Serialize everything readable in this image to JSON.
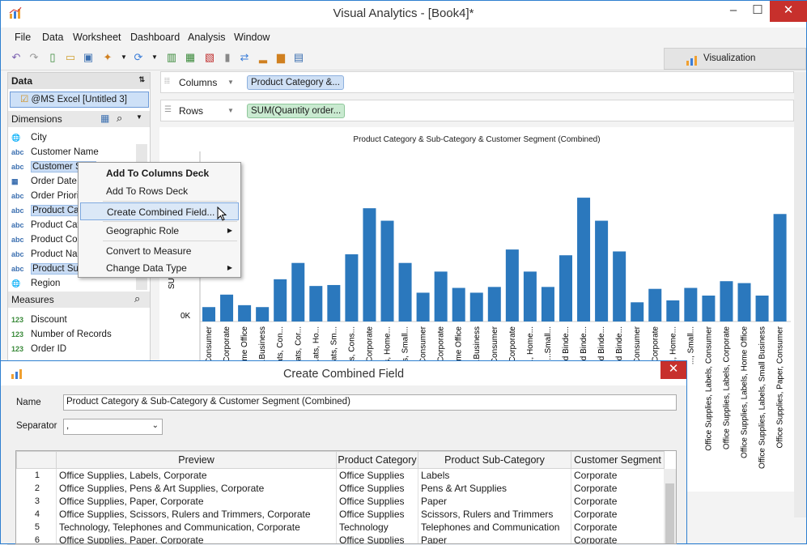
{
  "window": {
    "title": "Visual Analytics - [Book4]*",
    "min": "–",
    "max": "☐",
    "close": "✕"
  },
  "menu": [
    "File",
    "Data",
    "Worksheet",
    "Dashboard",
    "Analysis",
    "Window"
  ],
  "toolbar": {
    "viz_tab": "Visualization"
  },
  "data_panel": {
    "header": "Data",
    "source": "@MS Excel [Untitled 3]",
    "dimensions_header": "Dimensions",
    "dimensions": [
      {
        "type": "globe",
        "label": "City"
      },
      {
        "type": "abc",
        "label": "Customer Name"
      },
      {
        "type": "abc",
        "label": "Customer Se..."
      },
      {
        "type": "date",
        "label": "Order Date"
      },
      {
        "type": "abc",
        "label": "Order Priorit..."
      },
      {
        "type": "abc",
        "label": "Product Cat..."
      },
      {
        "type": "abc",
        "label": "Product Cat..."
      },
      {
        "type": "abc",
        "label": "Product Con..."
      },
      {
        "type": "abc",
        "label": "Product Nam..."
      },
      {
        "type": "abc",
        "label": "Product Sub..."
      },
      {
        "type": "globe",
        "label": "Region"
      }
    ],
    "measures_header": "Measures",
    "measures": [
      {
        "type": "123",
        "label": "Discount"
      },
      {
        "type": "123",
        "label": "Number of Records"
      },
      {
        "type": "123",
        "label": "Order ID"
      }
    ]
  },
  "shelves": {
    "columns_label": "Columns",
    "columns_pill": "Product Category &...",
    "rows_label": "Rows",
    "rows_pill": "SUM(Quantity order..."
  },
  "chart_data": {
    "type": "bar",
    "title": "Product Category & Sub-Category & Customer Segment (Combined)",
    "ylabel": "SU...",
    "ytick": "0K",
    "categories": [
      "...Consumer",
      "...Corporate",
      "...me Office",
      "...Business",
      "...ats, Con...",
      "...ats, Cor...",
      "...ats, Ho...",
      "...ats, Sm...",
      "...ts, Cons...",
      "...Corporate",
      "...s, Home...",
      "...s, Small...",
      "...Consumer",
      "...Corporate",
      "...me Office",
      "...Business",
      "...Consumer",
      "...Corporate",
      "..., Home...",
      "...Small...",
      "...d Binde...",
      "...d Binde...",
      "...d Binde...",
      "...d Binde...",
      "...Consumer",
      "...Corporate",
      "..., Home...",
      "..., Small...",
      "Office Supplies, Labels, Consumer",
      "Office Supplies, Labels, Corporate",
      "Office Supplies, Labels, Home Office",
      "Office Supplies, Labels, Small Business",
      "Office Supplies, Paper, Consumer"
    ],
    "values": [
      15,
      28,
      17,
      15,
      44,
      61,
      37,
      38,
      70,
      118,
      105,
      61,
      30,
      52,
      35,
      30,
      36,
      75,
      52,
      36,
      69,
      129,
      105,
      73,
      20,
      34,
      22,
      35,
      27,
      42,
      40,
      27,
      112
    ]
  },
  "context_menu": {
    "items": [
      {
        "label": "Add To Columns Deck",
        "bold": true
      },
      {
        "label": "Add To Rows Deck"
      },
      {
        "label": "Create Combined Field...",
        "selected": true
      },
      {
        "label": "Geographic Role",
        "submenu": true
      },
      {
        "label": "Convert to Measure"
      },
      {
        "label": "Change Data Type",
        "submenu": true
      }
    ]
  },
  "dialog": {
    "title": "Create Combined Field",
    "close": "✕",
    "name_label": "Name",
    "name_value": "Product Category & Sub-Category & Customer Segment (Combined)",
    "separator_label": "Separator",
    "separator_value": ",",
    "columns": [
      "Preview",
      "Product Category",
      "Product Sub-Category",
      "Customer Segment"
    ],
    "rows": [
      [
        "1",
        "Office Supplies, Labels, Corporate",
        "Office Supplies",
        "Labels",
        "Corporate"
      ],
      [
        "2",
        "Office Supplies, Pens & Art Supplies, Corporate",
        "Office Supplies",
        "Pens & Art Supplies",
        "Corporate"
      ],
      [
        "3",
        "Office Supplies, Paper, Corporate",
        "Office Supplies",
        "Paper",
        "Corporate"
      ],
      [
        "4",
        "Office Supplies, Scissors, Rulers and Trimmers, Corporate",
        "Office Supplies",
        "Scissors, Rulers and Trimmers",
        "Corporate"
      ],
      [
        "5",
        "Technology, Telephones and Communication, Corporate",
        "Technology",
        "Telephones and Communication",
        "Corporate"
      ],
      [
        "6",
        "Office Supplies, Paper, Corporate",
        "Office Supplies",
        "Paper",
        "Corporate"
      ]
    ]
  }
}
